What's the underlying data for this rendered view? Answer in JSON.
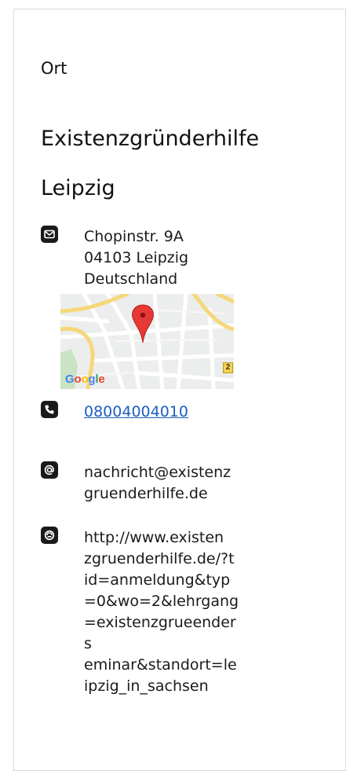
{
  "location": {
    "section_label": "Ort",
    "title_line1": "Existenzgründerhilfe",
    "title_line2": "Leipzig",
    "address": {
      "street": "Chopinstr. 9A",
      "city": "04103 Leipzig",
      "country": "Deutschland"
    },
    "map": {
      "attribution": "Google",
      "road_badge": "2"
    },
    "phone": "08004004010",
    "email": "nachricht@existenz\ngruenderhilfe.de",
    "website": "http://www.existen\nzgruenderhilfe.de/?t\nid=anmeldung&typ\n=0&wo=2&lehrgang\n=existenzgrueenders\neminar&standort=le\nipzig_in_sachsen"
  },
  "icons": {
    "address": "envelope-icon",
    "phone": "phone-icon",
    "email": "at-sign-icon",
    "website": "globe-link-icon"
  },
  "colors": {
    "link": "#1a5fbf",
    "icon_bg": "#1a1a1a",
    "border": "#dcdcdc",
    "map_pin": "#e53935"
  }
}
